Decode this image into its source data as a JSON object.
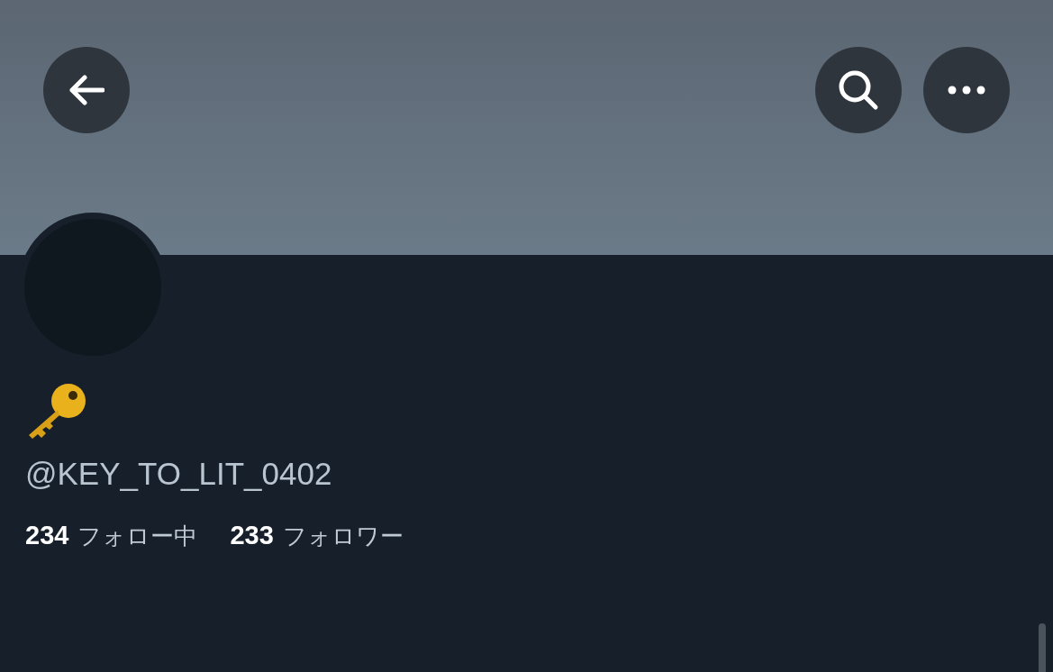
{
  "profile": {
    "handle": "@KEY_TO_LIT_0402",
    "stats": [
      {
        "count": "234",
        "label": "フォロー中"
      },
      {
        "count": "233",
        "label": "フォロワー"
      }
    ]
  }
}
